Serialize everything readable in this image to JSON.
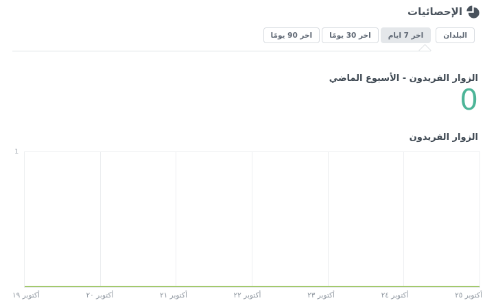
{
  "header": {
    "title": "الإحصائيات",
    "icon": "pie-chart-icon"
  },
  "toolbar": {
    "countries_button": "البلدان",
    "tabs": [
      {
        "label": "اخر 7 ايام",
        "selected": true
      },
      {
        "label": "اخر 30 يومًا",
        "selected": false
      },
      {
        "label": "اخر 90 يومًا",
        "selected": false
      }
    ]
  },
  "summary": {
    "title": "الزوار الفريدون - الأسبوع الماضي",
    "value": "0"
  },
  "colors": {
    "accent_teal": "#4db598",
    "line_green": "#a3c96d",
    "header_text": "#49525c",
    "selected_tab_bg": "#e4e7ea"
  },
  "chart_data": {
    "type": "line",
    "title": "الزوار الفريدون",
    "categories": [
      "أكتوبر ١٩",
      "أكتوبر ٢٠",
      "أكتوبر ٢١",
      "أكتوبر ٢٢",
      "أكتوبر ٢٣",
      "أكتوبر ٢٤",
      "أكتوبر ٢٥"
    ],
    "values": [
      0,
      0,
      0,
      0,
      0,
      0,
      0
    ],
    "xlabel": "",
    "ylabel": "",
    "ylim": [
      0,
      1
    ],
    "y_tick_labels": [
      "1"
    ],
    "grid": true,
    "legend": "none",
    "line_color": "#a3c96d"
  }
}
